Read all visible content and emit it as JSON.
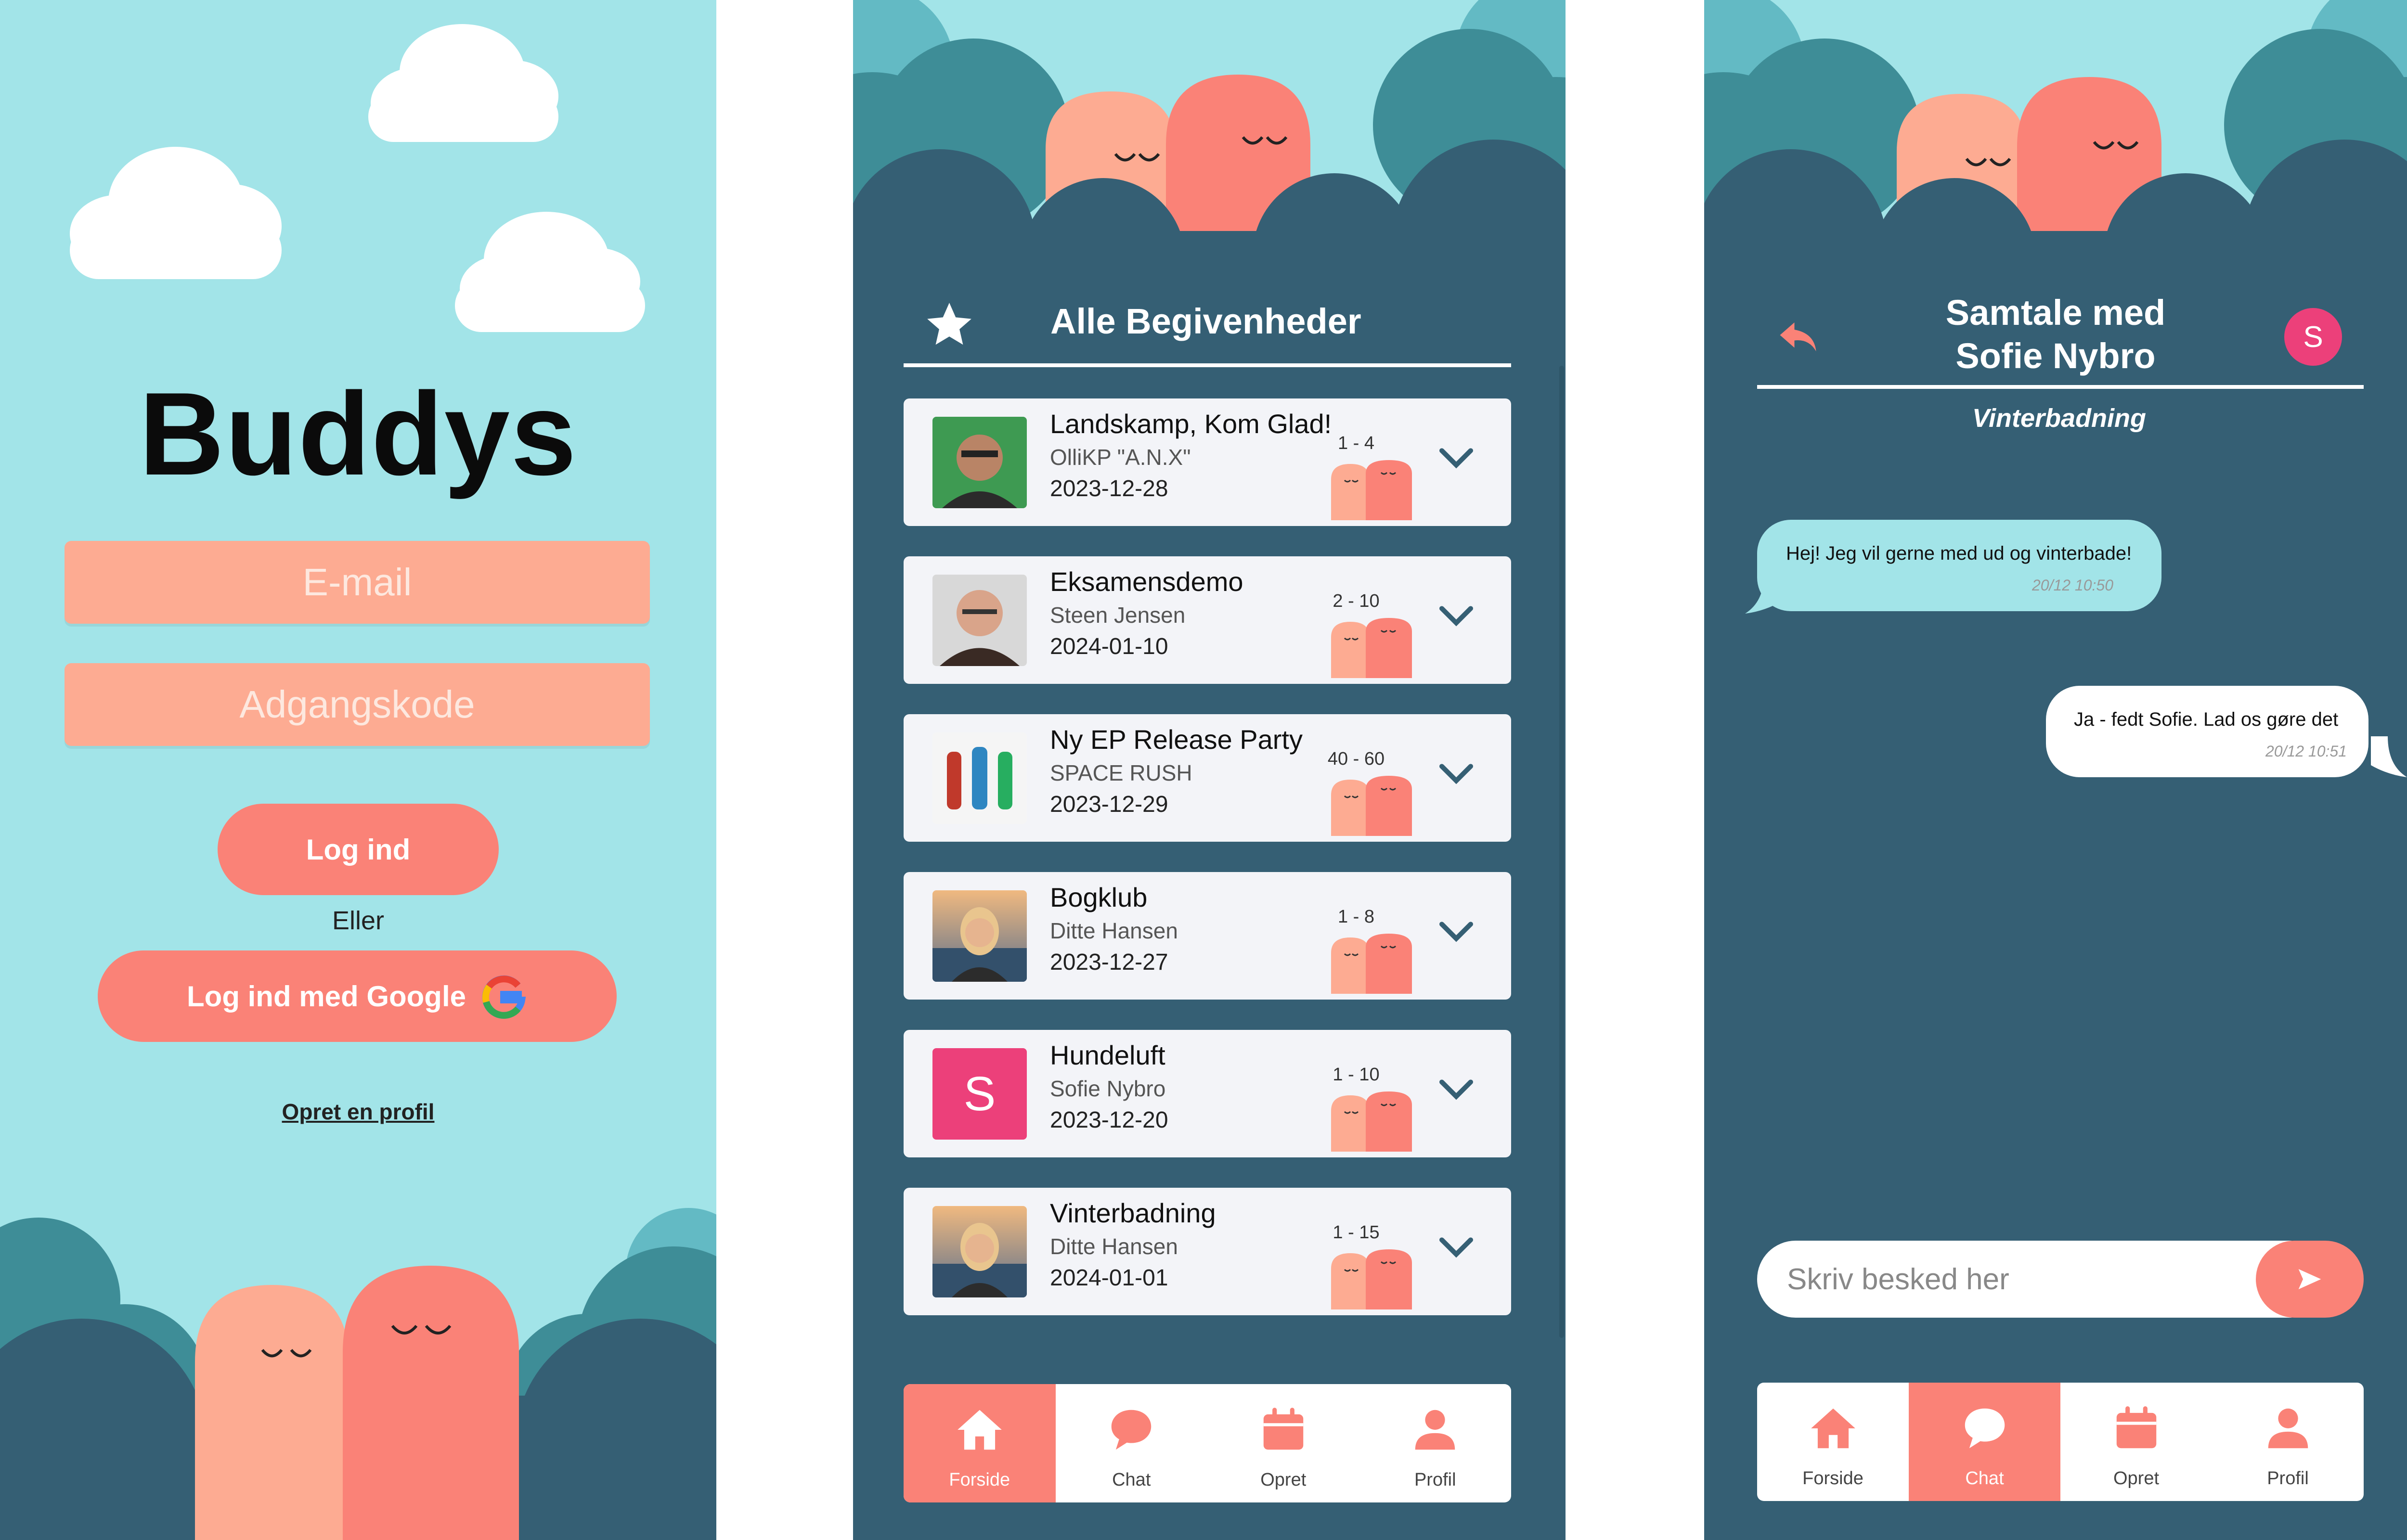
{
  "login": {
    "brand": "Buddys",
    "email_placeholder": "E-mail",
    "password_placeholder": "Adgangskode",
    "login_label": "Log ind",
    "or_label": "Eller",
    "google_label": "Log ind med Google",
    "create_profile_label": "Opret en profil"
  },
  "events": {
    "title": "Alle Begivenheder",
    "items": [
      {
        "title": "Landskamp, Kom Glad!",
        "organizer": "OlliKP \"A.N.X\"",
        "date": "2023-12-28",
        "capacity": "1 - 4",
        "image": "photo-man-glasses"
      },
      {
        "title": "Eksamensdemo",
        "organizer": "Steen Jensen",
        "date": "2024-01-10",
        "capacity": "2 - 10",
        "image": "photo-man-bald"
      },
      {
        "title": "Ny EP Release Party",
        "organizer": "SPACE RUSH",
        "date": "2023-12-29",
        "capacity": "40 - 60",
        "image": "photo-band-figures"
      },
      {
        "title": "Bogklub",
        "organizer": "Ditte Hansen",
        "date": "2023-12-27",
        "capacity": "1 - 8",
        "image": "photo-woman-sunset"
      },
      {
        "title": "Hundeluft",
        "organizer": "Sofie Nybro",
        "date": "2023-12-20",
        "capacity": "1 - 10",
        "image": "letter-avatar",
        "avatar_letter": "S"
      },
      {
        "title": "Vinterbadning",
        "organizer": "Ditte Hansen",
        "date": "2024-01-01",
        "capacity": "1 - 15",
        "image": "photo-woman-sunset"
      }
    ]
  },
  "nav": {
    "items": [
      {
        "label": "Forside",
        "icon": "home-icon"
      },
      {
        "label": "Chat",
        "icon": "chat-icon"
      },
      {
        "label": "Opret",
        "icon": "calendar-icon"
      },
      {
        "label": "Profil",
        "icon": "profile-icon"
      }
    ]
  },
  "nav_events_active": "Forside",
  "nav_chat_active": "Chat",
  "chat": {
    "title_line1": "Samtale med",
    "title_line2": "Sofie Nybro",
    "avatar_letter": "S",
    "subtitle": "Vinterbadning",
    "messages": [
      {
        "text": "Hej! Jeg vil gerne med ud og vinterbade!",
        "time": "20/12 10:50",
        "side": "received"
      },
      {
        "text": "Ja - fedt Sofie. Lad os gøre det",
        "time": "20/12 10:51",
        "side": "sent"
      }
    ],
    "input_placeholder": "Skriv besked her"
  },
  "colors": {
    "sky": "#a2e4e8",
    "deep": "#355f74",
    "teal": "#3e8d97",
    "salmon": "#fa8277",
    "peach": "#fdab92",
    "received_bubble": "#a2e4e8",
    "avatar_pink": "#ec407a"
  }
}
